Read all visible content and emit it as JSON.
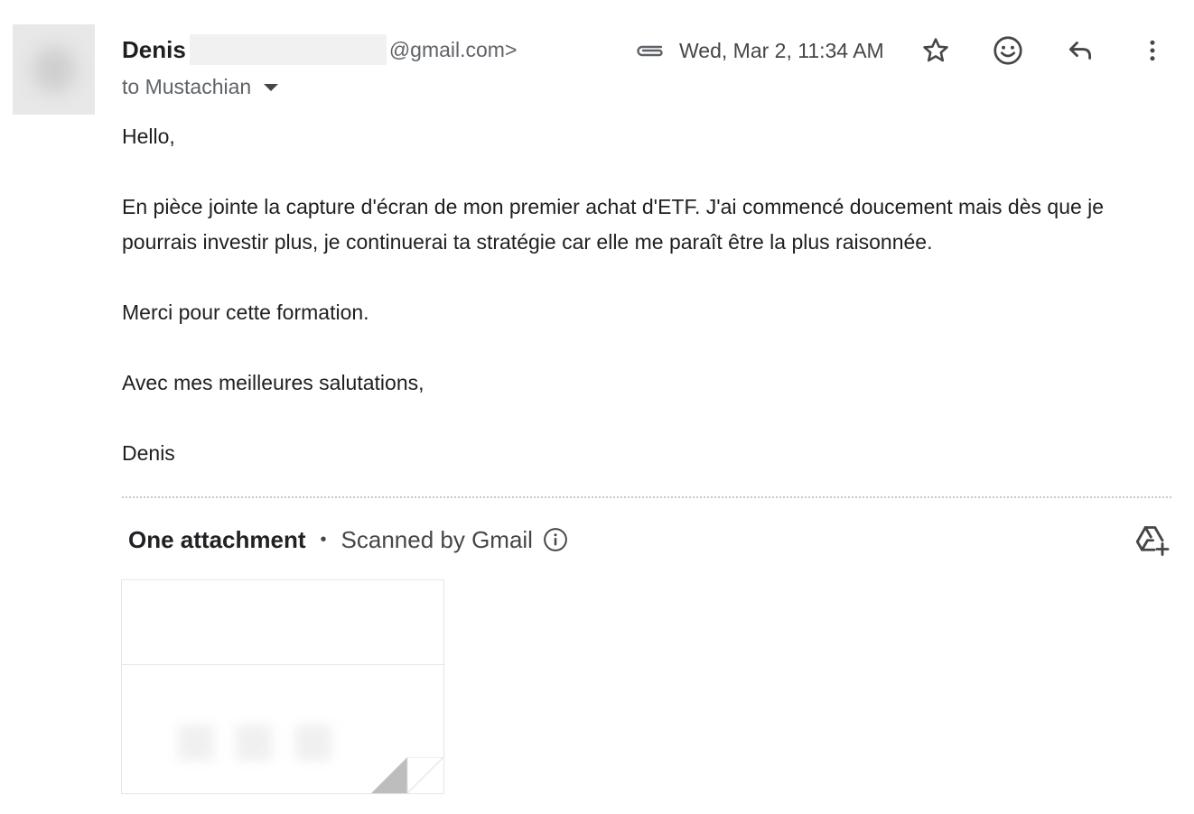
{
  "header": {
    "sender_name": "Denis",
    "sender_email_suffix": "@gmail.com>",
    "recipient": "to Mustachian",
    "date": "Wed, Mar 2, 11:34 AM"
  },
  "icons": {
    "attachment": "paperclip-icon",
    "star": "star-icon",
    "emoji": "emoji-icon",
    "reply": "reply-icon",
    "more": "more-vert-icon",
    "recipient_dropdown": "chevron-down-icon",
    "info": "info-icon",
    "drive": "add-to-drive-icon"
  },
  "body": {
    "greeting": "Hello,",
    "paragraph": "En pièce jointe la capture d'écran de mon premier achat d'ETF. J'ai commencé doucement mais dès que je pourrais investir plus, je continuerai ta stratégie car elle me paraît être la plus raisonnée.",
    "thanks": "Merci pour cette formation.",
    "closing": "Avec mes meilleures salutations,",
    "signature": "Denis"
  },
  "attachments": {
    "title": "One attachment",
    "separator": "•",
    "scanned": "Scanned by Gmail"
  }
}
